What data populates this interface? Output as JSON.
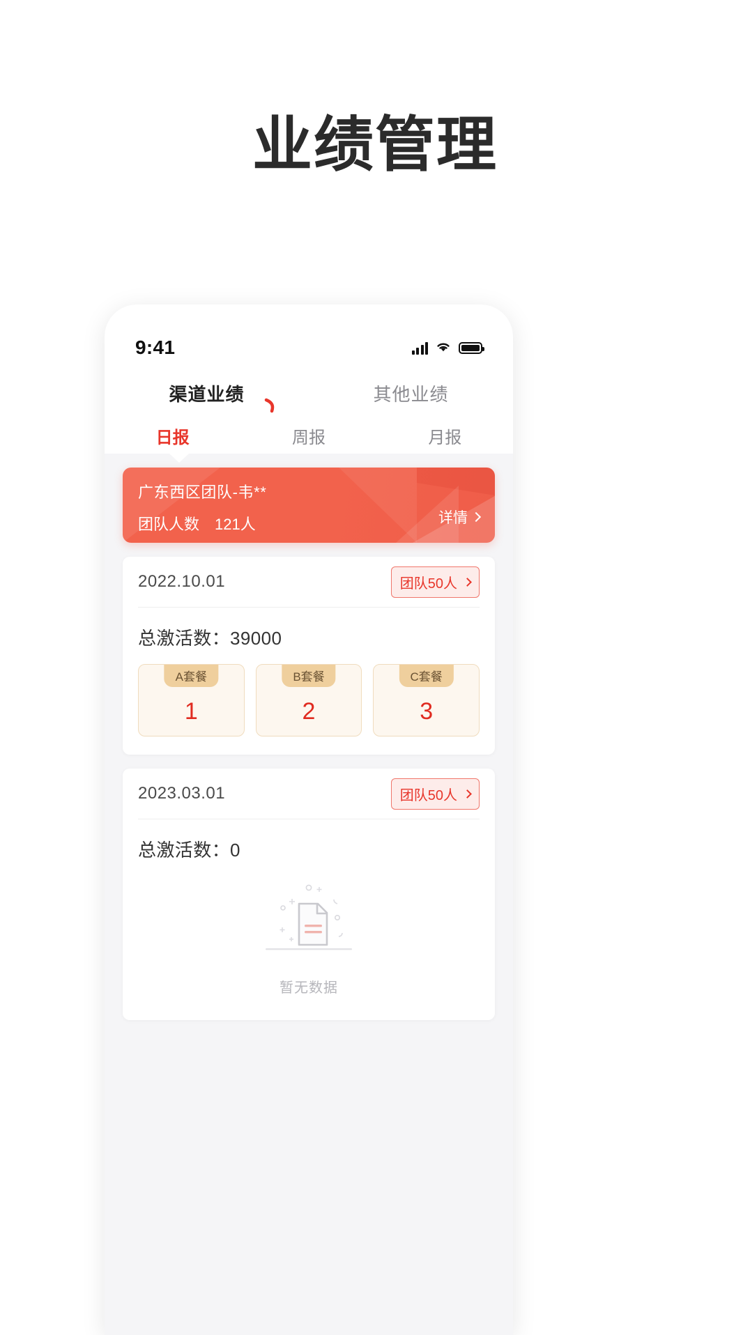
{
  "page": {
    "title": "业绩管理"
  },
  "status_bar": {
    "time": "9:41",
    "signal_icon": "signal-bars-icon",
    "wifi_icon": "wifi-icon",
    "battery_icon": "battery-icon"
  },
  "top_tabs": {
    "items": [
      {
        "label": "渠道业绩",
        "active": true
      },
      {
        "label": "其他业绩",
        "active": false
      }
    ]
  },
  "sub_tabs": {
    "items": [
      {
        "label": "日报",
        "active": true
      },
      {
        "label": "周报",
        "active": false
      },
      {
        "label": "月报",
        "active": false
      }
    ]
  },
  "team_banner": {
    "name": "广东西区团队-韦**",
    "count_label": "团队人数",
    "count_value": "121人",
    "detail_label": "详情",
    "chevron_icon": "chevron-right-icon",
    "color": "#F2624C"
  },
  "records": [
    {
      "date": "2022.10.01",
      "team_badge": "团队50人",
      "badge_chevron_icon": "chevron-right-icon",
      "total_label": "总激活数：",
      "total_value": "39000",
      "packages": [
        {
          "name": "A套餐",
          "value": "1"
        },
        {
          "name": "B套餐",
          "value": "2"
        },
        {
          "name": "C套餐",
          "value": "3"
        }
      ],
      "empty": false
    },
    {
      "date": "2023.03.01",
      "team_badge": "团队50人",
      "badge_chevron_icon": "chevron-right-icon",
      "total_label": "总激活数：",
      "total_value": "0",
      "packages": [],
      "empty": true,
      "empty_text": "暂无数据",
      "empty_icon": "empty-document-icon"
    }
  ],
  "theme": {
    "accent_red": "#E8362B",
    "banner_red": "#F2624C",
    "package_tan": "#EFCF9D",
    "package_bg": "#FDF7EF",
    "page_bg": "#F5F5F7",
    "muted_text": "#8A8A8F"
  }
}
